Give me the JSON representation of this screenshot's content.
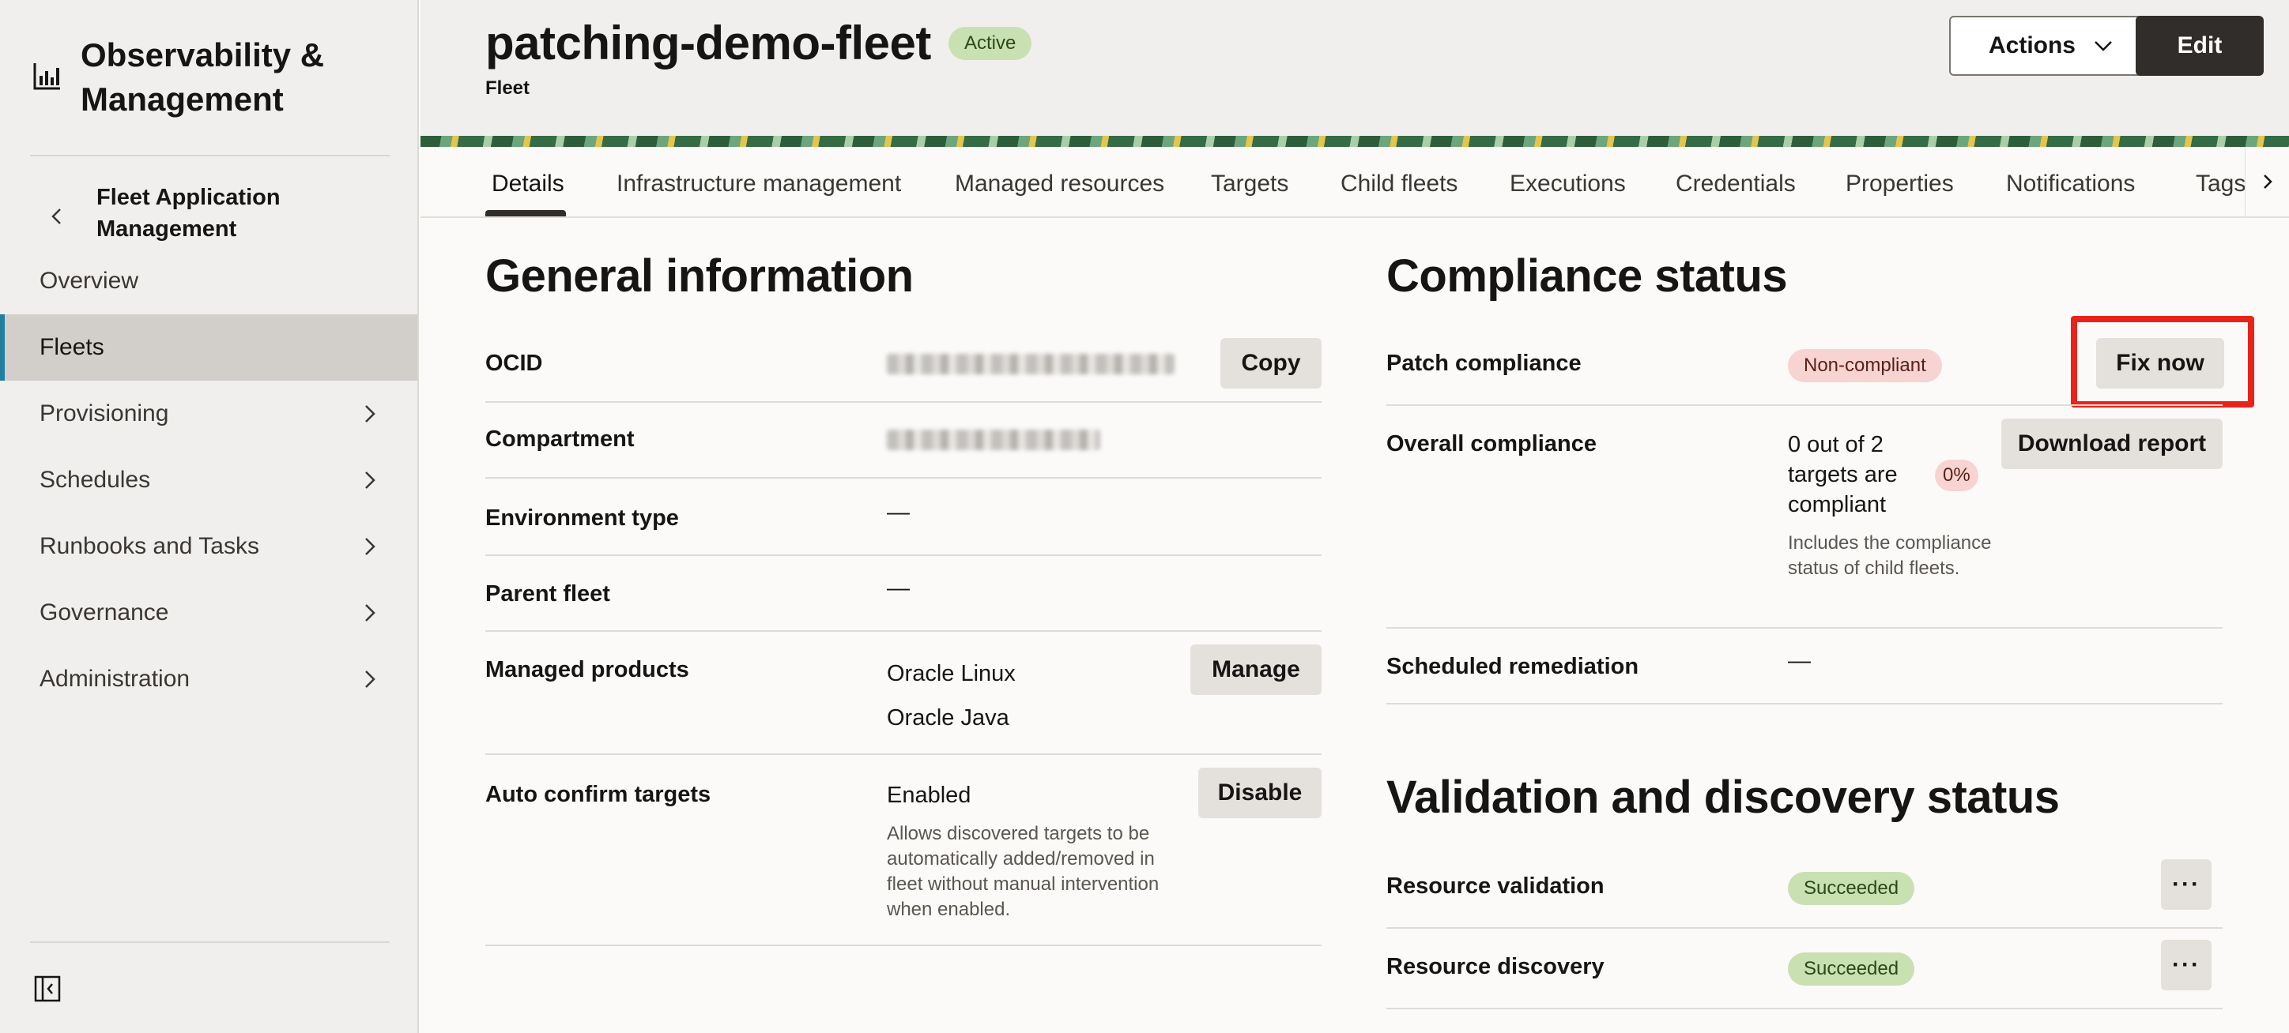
{
  "sidebar": {
    "brand_title": "Observability & Management",
    "back_label": "Fleet Application Management",
    "items": [
      {
        "label": "Overview",
        "has_children": false,
        "active": false
      },
      {
        "label": "Fleets",
        "has_children": false,
        "active": true
      },
      {
        "label": "Provisioning",
        "has_children": true,
        "active": false
      },
      {
        "label": "Schedules",
        "has_children": true,
        "active": false
      },
      {
        "label": "Runbooks and Tasks",
        "has_children": true,
        "active": false
      },
      {
        "label": "Governance",
        "has_children": true,
        "active": false
      },
      {
        "label": "Administration",
        "has_children": true,
        "active": false
      }
    ],
    "icons": {
      "brand": "chart-bars-icon",
      "back": "chevron-left-icon",
      "collapse": "sidebar-collapse-icon"
    }
  },
  "header": {
    "title": "patching-demo-fleet",
    "status": "Active",
    "subtitle": "Fleet",
    "actions_label": "Actions",
    "edit_label": "Edit"
  },
  "tabs": [
    {
      "label": "Details",
      "active": true
    },
    {
      "label": "Infrastructure management"
    },
    {
      "label": "Managed resources"
    },
    {
      "label": "Targets"
    },
    {
      "label": "Child fleets"
    },
    {
      "label": "Executions"
    },
    {
      "label": "Credentials"
    },
    {
      "label": "Properties"
    },
    {
      "label": "Notifications"
    },
    {
      "label": "Tags"
    }
  ],
  "general": {
    "title": "General information",
    "ocid_label": "OCID",
    "copy_label": "Copy",
    "compartment_label": "Compartment",
    "env_label": "Environment type",
    "env_value": "—",
    "parent_label": "Parent fleet",
    "parent_value": "—",
    "products_label": "Managed products",
    "products": [
      "Oracle Linux",
      "Oracle Java"
    ],
    "manage_label": "Manage",
    "auto_label": "Auto confirm targets",
    "auto_value": "Enabled",
    "auto_help": "Allows discovered targets to be automatically added/removed in fleet without manual intervention when enabled.",
    "disable_label": "Disable"
  },
  "compliance": {
    "title": "Compliance status",
    "patch_label": "Patch compliance",
    "patch_status": "Non-compliant",
    "fix_label": "Fix now",
    "overall_label": "Overall compliance",
    "overall_value": "0 out of 2 targets are compliant",
    "overall_pct": "0%",
    "overall_help": "Includes the compliance status of child fleets.",
    "download_label": "Download report",
    "sched_label": "Scheduled remediation",
    "sched_value": "—"
  },
  "validation": {
    "title": "Validation and discovery status",
    "rows": [
      {
        "label": "Resource validation",
        "status": "Succeeded"
      },
      {
        "label": "Resource discovery",
        "status": "Succeeded"
      }
    ],
    "more_label": "···"
  },
  "colors": {
    "accent": "#227e9e",
    "highlight": "#e8231a",
    "success_bg": "#c9e0b3",
    "danger_bg": "#f7d4d1"
  }
}
